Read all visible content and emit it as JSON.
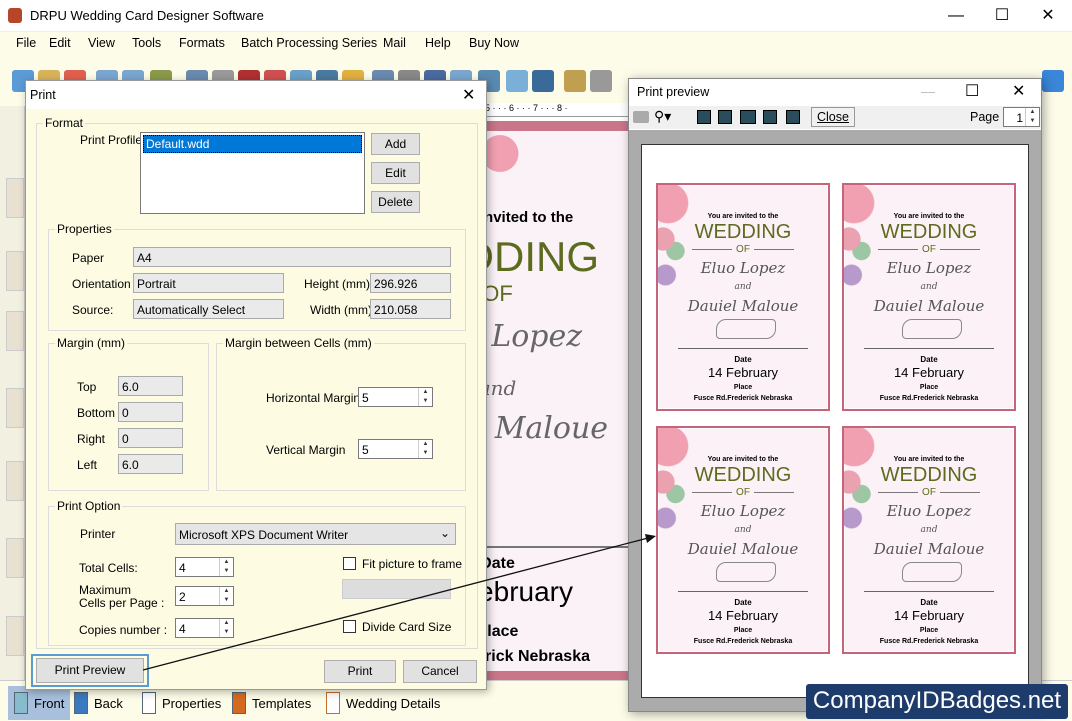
{
  "app": {
    "title": "DRPU Wedding Card Designer Software",
    "minimize": "—",
    "maximize": "☐",
    "close": "✕"
  },
  "menu": [
    "File",
    "Edit",
    "View",
    "Tools",
    "Formats",
    "Batch Processing Series",
    "Mail",
    "Help",
    "Buy Now"
  ],
  "canvas": {
    "ruler": "5 · · · 6 · · · 7 · · · 8 ·"
  },
  "card": {
    "invited": "You are invited to the",
    "wedding": "WEDDING",
    "of": "OF",
    "name1": "Eluo Lopez",
    "and": "and",
    "name2": "Dauiel Maloue",
    "date_label": "Date",
    "date": "14 February",
    "place_label": "Place",
    "place": "Fusce Rd.Frederick Nebraska"
  },
  "bottom_tabs": [
    "Front",
    "Back",
    "Properties",
    "Templates",
    "Wedding Details"
  ],
  "dialog": {
    "title": "Print",
    "close": "✕",
    "format": {
      "label": "Format",
      "profile_label": "Print Profile",
      "profiles": [
        "Default.wdd"
      ],
      "add": "Add",
      "edit": "Edit",
      "delete": "Delete"
    },
    "properties": {
      "label": "Properties",
      "paper_label": "Paper",
      "paper": "A4",
      "orientation_label": "Orientation",
      "orientation": "Portrait",
      "source_label": "Source:",
      "source": "Automatically Select",
      "height_label": "Height (mm)",
      "height": "296.926",
      "width_label": "Width (mm)",
      "width": "210.058"
    },
    "margin": {
      "label": "Margin (mm)",
      "top_label": "Top",
      "top": "6.0",
      "bottom_label": "Bottom",
      "bottom": "0",
      "right_label": "Right",
      "right": "0",
      "left_label": "Left",
      "left": "6.0"
    },
    "cell_margin": {
      "label": "Margin between Cells (mm)",
      "horizontal_label": "Horizontal Margin",
      "horizontal": "5",
      "vertical_label": "Vertical Margin",
      "vertical": "5"
    },
    "print_option": {
      "label": "Print Option",
      "printer_label": "Printer",
      "printer": "Microsoft XPS Document Writer",
      "total_cells_label": "Total Cells:",
      "total_cells": "4",
      "max_cells_label": "Maximum\nCells per Page :",
      "max_cells": "2",
      "copies_label": "Copies number :",
      "copies": "4",
      "fit_label": "Fit picture to frame",
      "fit_checked": false,
      "divide_label": "Divide Card Size",
      "divide_checked": false
    },
    "print_preview": "Print Preview",
    "print": "Print",
    "cancel": "Cancel"
  },
  "preview": {
    "title": "Print preview",
    "minimize": "—",
    "maximize": "☐",
    "close": "✕",
    "close_button": "Close",
    "page_label": "Page",
    "page": "1"
  },
  "watermark": "CompanyIDBadges.net",
  "colors": {
    "accent": "#5d6b1f",
    "card_border": "#c5647a",
    "highlight": "#5b9bd5",
    "watermark_bg": "#1d3c6b"
  }
}
